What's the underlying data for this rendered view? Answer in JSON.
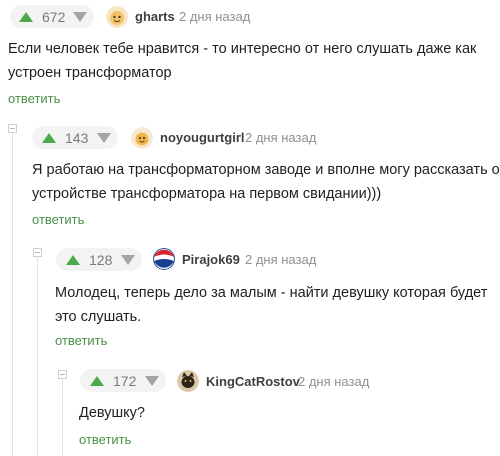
{
  "comments": [
    {
      "rating": "672",
      "username": "gharts",
      "time": "2 дня назад",
      "lines": [
        "Если человек тебе нравится - то интересно от него слушать даже как",
        "устроен трансформатор"
      ],
      "reply_label": "ответить"
    },
    {
      "rating": "143",
      "username": "noyougurtgirl",
      "time": "2 дня назад",
      "lines": [
        "Я работаю на трансформаторном заводе и вполне могу рассказать об",
        "устройстве трансформатора на первом свидании)))"
      ],
      "reply_label": "ответить"
    },
    {
      "rating": "128",
      "username": "Pirajok69",
      "time": "2 дня назад",
      "lines": [
        "Молодец, теперь дело за малым - найти девушку которая будет",
        "это слушать."
      ],
      "reply_label": "ответить"
    },
    {
      "rating": "172",
      "username": "KingCatRostov",
      "time": "2 дня назад",
      "lines": [
        "Девушку?"
      ],
      "reply_label": "ответить"
    }
  ],
  "colors": {
    "upvote": "#4caa4a",
    "downvote": "#a4a4a4",
    "reply": "#4b8f47",
    "pill": "#f3f3f3"
  }
}
